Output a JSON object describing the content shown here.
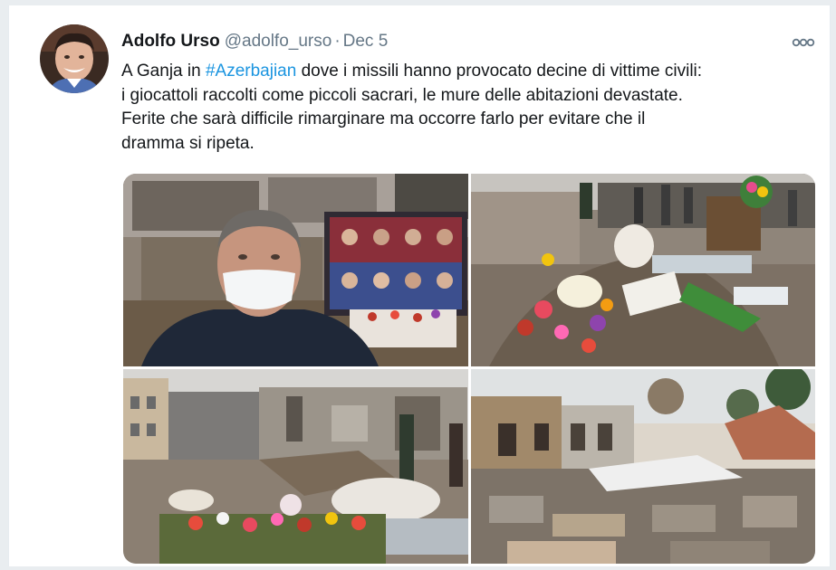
{
  "tweet": {
    "author": {
      "display_name": "Adolfo Urso",
      "handle": "@adolfo_urso"
    },
    "separator": "·",
    "date": "Dec 5",
    "text": {
      "line1_before": "A Ganja in ",
      "hashtag": "#Azerbajian",
      "line1_after": " dove i missili hanno provocato decine di vittime civili:",
      "line2": "i giocattoli raccolti come piccoli sacrari, le mure delle abitazioni devastate.",
      "line3": "Ferite che sarà difficile rimarginare ma occorre farlo per evitare che il",
      "line4": "dramma si ripeta."
    },
    "media": [
      {
        "subject": "selfie with face mask in front of memorial photo board"
      },
      {
        "subject": "toys and flowers piled on rubble as memorial"
      },
      {
        "subject": "destroyed buildings with flowers and toys in foreground"
      },
      {
        "subject": "collapsed houses and debris"
      }
    ]
  },
  "icons": {
    "more": "more-options-icon",
    "avatar": "avatar"
  },
  "colors": {
    "link": "#1b95e0",
    "text": "#14171a",
    "secondary": "#657786"
  }
}
